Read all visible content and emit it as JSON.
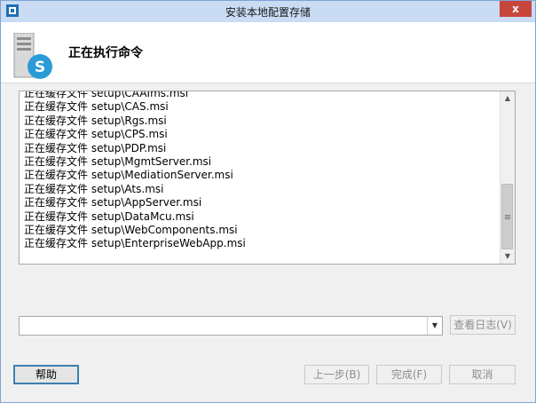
{
  "window": {
    "title": "安装本地配置存储",
    "close_label": "x"
  },
  "header": {
    "heading": "正在执行命令",
    "product_logo_letter": "S",
    "brand_color": "#2b9bd8"
  },
  "log": {
    "lines": [
      "正在缓存文件 setup\\CAAIms.msi",
      "正在缓存文件 setup\\CAS.msi",
      "正在缓存文件 setup\\Rgs.msi",
      "正在缓存文件 setup\\CPS.msi",
      "正在缓存文件 setup\\PDP.msi",
      "正在缓存文件 setup\\MgmtServer.msi",
      "正在缓存文件 setup\\MediationServer.msi",
      "正在缓存文件 setup\\Ats.msi",
      "正在缓存文件 setup\\AppServer.msi",
      "正在缓存文件 setup\\DataMcu.msi",
      "正在缓存文件 setup\\WebComponents.msi",
      "正在缓存文件 setup\\EnterpriseWebApp.msi"
    ]
  },
  "buttons": {
    "view_log": "查看日志(V)",
    "help": "帮助",
    "back": "上一步(B)",
    "finish": "完成(F)",
    "cancel": "取消"
  }
}
